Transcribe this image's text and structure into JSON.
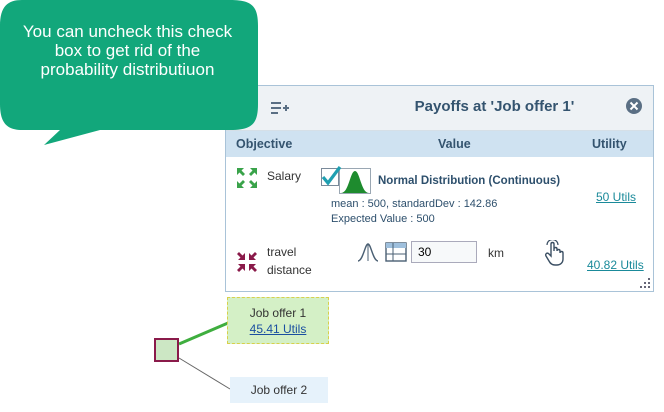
{
  "callout": {
    "text": "You can uncheck this check box to get rid of the probability distributiuon",
    "color": "#12a77b"
  },
  "panel": {
    "title": "Payoffs at 'Job offer 1'",
    "columns": {
      "objective": "Objective",
      "value": "Value",
      "utility": "Utility"
    },
    "rows": [
      {
        "objective": "Salary",
        "icon": "expand-arrows-icon",
        "distribution_checked": true,
        "distribution_name": "Normal Distribution (Continuous)",
        "params_line1": "mean : 500,   standardDev : 142.86",
        "params_line2": "Expected Value : 500",
        "utility": "50 Utils"
      },
      {
        "objective": "travel distance",
        "objective_line1": "travel",
        "objective_line2": "distance",
        "icon": "compress-arrows-icon",
        "value": "30",
        "unit": "km",
        "utility": "40.82 Utils"
      }
    ]
  },
  "nodes": {
    "job_offer_1": {
      "title": "Job offer 1",
      "utility": "45.41 Utils"
    },
    "job_offer_2": {
      "title": "Job offer 2"
    }
  },
  "colors": {
    "panel_header_bg": "#eef2f5",
    "column_header_bg": "#cfe2f1",
    "accent_teal": "#1a8a9a",
    "node_green": "#d4f0c6",
    "decision_border": "#8a1a4a"
  }
}
